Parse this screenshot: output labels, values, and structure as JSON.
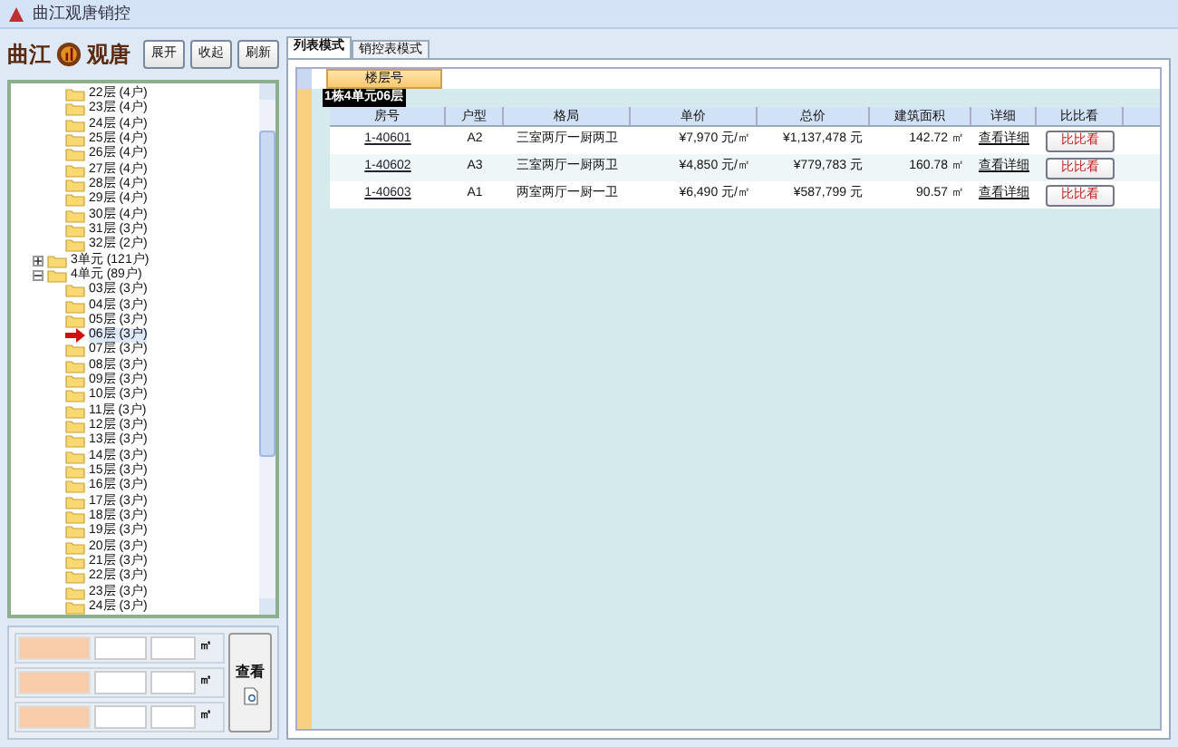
{
  "window": {
    "title": "曲江观唐销控"
  },
  "logo": {
    "left": "曲江",
    "right": "观唐"
  },
  "toolbar": [
    "展开",
    "收起",
    "刷新"
  ],
  "tree": [
    {
      "label": "22层 (4户)",
      "selected": false
    },
    {
      "label": "23层 (4户)",
      "selected": false
    },
    {
      "label": "24层 (4户)",
      "selected": false
    },
    {
      "label": "25层 (4户)",
      "selected": false
    },
    {
      "label": "26层 (4户)",
      "selected": false
    },
    {
      "label": "27层 (4户)",
      "selected": false
    },
    {
      "label": "28层 (4户)",
      "selected": false
    },
    {
      "label": "29层 (4户)",
      "selected": false
    },
    {
      "label": "30层 (4户)",
      "selected": false
    },
    {
      "label": "31层 (3户)",
      "selected": false
    },
    {
      "label": "32层 (2户)",
      "selected": false
    },
    {
      "label": "3单元 (121户)",
      "unit": true,
      "expanded": false,
      "selected": false
    },
    {
      "label": "4单元 (89户)",
      "unit": true,
      "expanded": true,
      "selected": false
    },
    {
      "label": "03层 (3户)",
      "selected": false
    },
    {
      "label": "04层 (3户)",
      "selected": false
    },
    {
      "label": "05层 (3户)",
      "selected": false
    },
    {
      "label": "06层 (3户)",
      "selected": true
    },
    {
      "label": "07层 (3户)",
      "selected": false
    },
    {
      "label": "08层 (3户)",
      "selected": false
    },
    {
      "label": "09层 (3户)",
      "selected": false
    },
    {
      "label": "10层 (3户)",
      "selected": false
    },
    {
      "label": "11层 (3户)",
      "selected": false
    },
    {
      "label": "12层 (3户)",
      "selected": false
    },
    {
      "label": "13层 (3户)",
      "selected": false
    },
    {
      "label": "14层 (3户)",
      "selected": false
    },
    {
      "label": "15层 (3户)",
      "selected": false
    },
    {
      "label": "16层 (3户)",
      "selected": false
    },
    {
      "label": "17层 (3户)",
      "selected": false
    },
    {
      "label": "18层 (3户)",
      "selected": false
    },
    {
      "label": "19层 (3户)",
      "selected": false
    },
    {
      "label": "20层 (3户)",
      "selected": false
    },
    {
      "label": "21层 (3户)",
      "selected": false
    },
    {
      "label": "22层 (3户)",
      "selected": false
    },
    {
      "label": "23层 (3户)",
      "selected": false
    },
    {
      "label": "24层 (3户)",
      "selected": false
    }
  ],
  "area_filter": {
    "units": [
      "㎡",
      "㎡",
      "㎡"
    ],
    "button": "查看"
  },
  "tabs": [
    {
      "label": "列表模式",
      "selected": true
    },
    {
      "label": "销控表模式",
      "selected": false
    }
  ],
  "group_header": "楼层号",
  "group": "1栋4单元06层",
  "columns": [
    "房号",
    "户型",
    "格局",
    "单价",
    "总价",
    "建筑面积",
    "详细",
    "比比看"
  ],
  "rows": [
    {
      "room": "1-40601",
      "type": "A2",
      "layout": "三室两厅一厨两卫",
      "unit_price": "¥7,970 元/㎡",
      "total": "¥1,137,478 元",
      "area": "142.72 ㎡",
      "detail": "查看详细",
      "compare": "比比看"
    },
    {
      "room": "1-40602",
      "type": "A3",
      "layout": "三室两厅一厨两卫",
      "unit_price": "¥4,850 元/㎡",
      "total": "¥779,783 元",
      "area": "160.78 ㎡",
      "detail": "查看详细",
      "compare": "比比看"
    },
    {
      "room": "1-40603",
      "type": "A1",
      "layout": "两室两厅一厨一卫",
      "unit_price": "¥6,490 元/㎡",
      "total": "¥587,799 元",
      "area": "90.57 ㎡",
      "detail": "查看详细",
      "compare": "比比看"
    }
  ]
}
